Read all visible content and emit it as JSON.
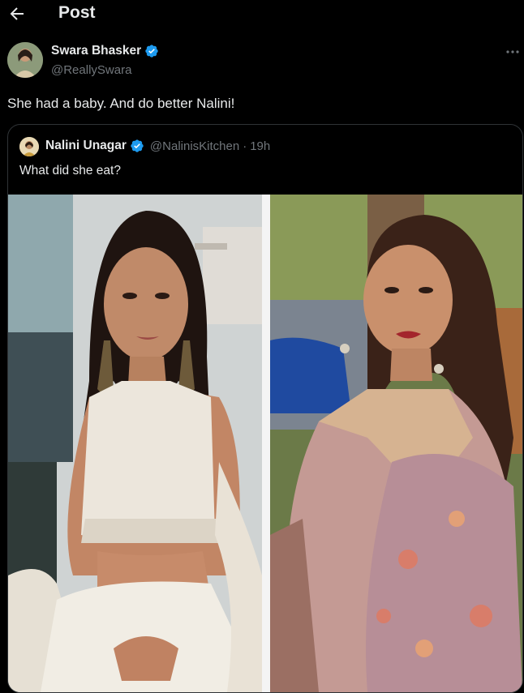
{
  "header": {
    "title": "Post"
  },
  "author": {
    "name": "Swara Bhasker",
    "handle": "@ReallySwara",
    "verified_color": "#1d9bf0"
  },
  "post": {
    "text": "She had a baby. And do better Nalini!"
  },
  "quote": {
    "name": "Nalini Unagar",
    "handle": "@NalinisKitchen",
    "separator": "·",
    "time": "19h",
    "text": "What did she eat?"
  },
  "icons": {
    "back": "arrow-left-icon",
    "more": "more-horizontal-icon",
    "verified": "verified-badge-icon"
  },
  "colors": {
    "background": "#000000",
    "text": "#e7e9ea",
    "secondary": "#71767b",
    "accent": "#1d9bf0"
  }
}
